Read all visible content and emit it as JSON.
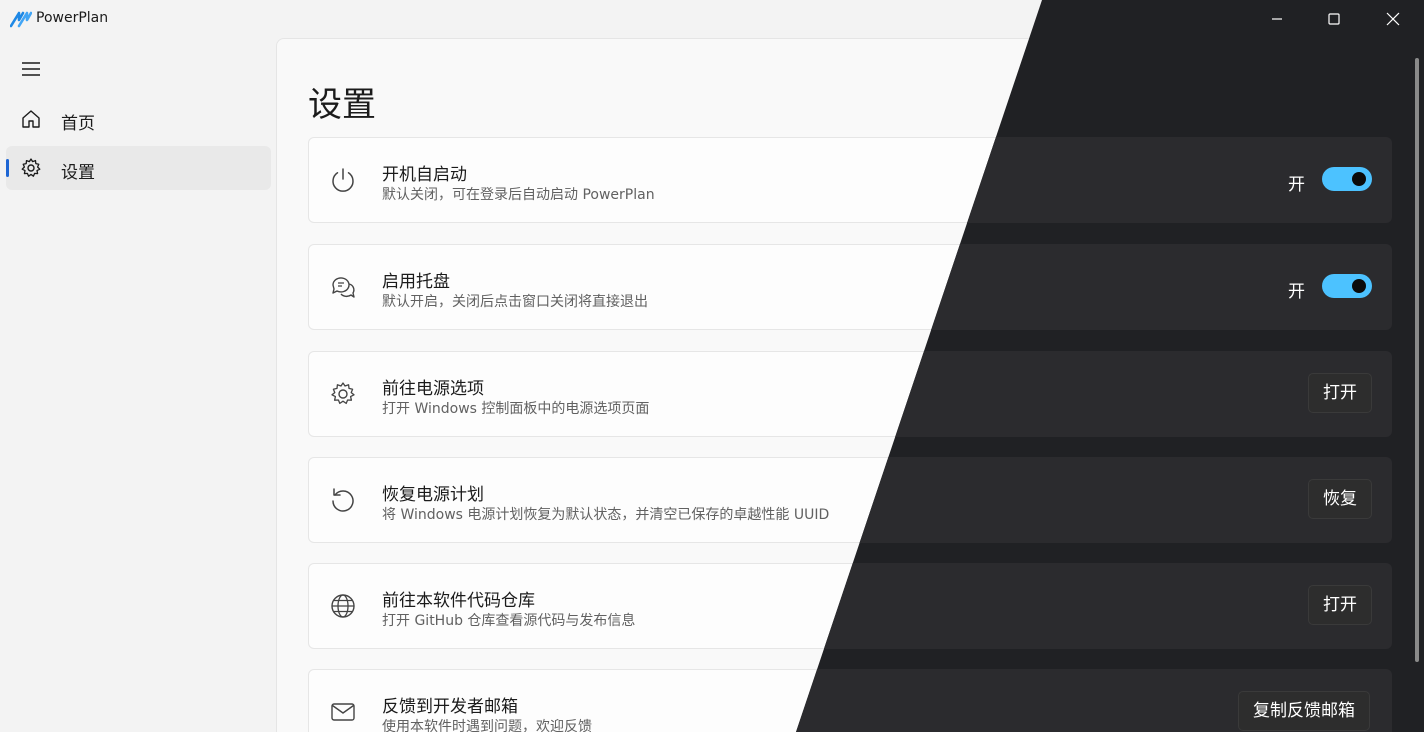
{
  "app": {
    "title": "PowerPlan"
  },
  "nav": {
    "items": [
      {
        "label": "首页"
      },
      {
        "label": "设置"
      }
    ]
  },
  "page": {
    "title": "设置"
  },
  "settings": [
    {
      "title": "开机自启动",
      "desc": "默认关闭，可在登录后自动启动 PowerPlan",
      "control": "toggle",
      "state": "开"
    },
    {
      "title": "启用托盘",
      "desc": "默认开启，关闭后点击窗口关闭将直接退出",
      "control": "toggle",
      "state": "开"
    },
    {
      "title": "前往电源选项",
      "desc": "打开 Windows 控制面板中的电源选项页面",
      "control": "button",
      "button": "打开"
    },
    {
      "title": "恢复电源计划",
      "desc": "将 Windows 电源计划恢复为默认状态，并清空已保存的卓越性能 UUID",
      "control": "button",
      "button": "恢复"
    },
    {
      "title": "前往本软件代码仓库",
      "desc": "打开 GitHub 仓库查看源代码与发布信息",
      "control": "button",
      "button": "打开"
    },
    {
      "title": "反馈到开发者邮箱",
      "desc": "使用本软件时遇到问题，欢迎反馈",
      "control": "button",
      "button": "复制反馈邮箱"
    }
  ],
  "colors": {
    "accent": "#1e66d4",
    "toggle_on": "#4cc2ff",
    "dark_bg": "#202124"
  }
}
